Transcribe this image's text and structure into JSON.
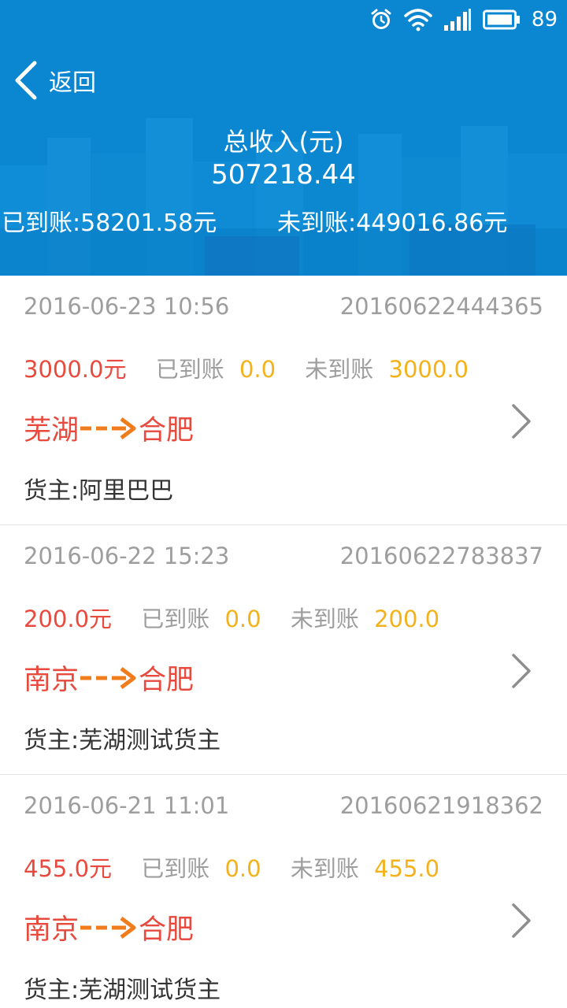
{
  "status_bar": {
    "battery_level": "89",
    "icons": [
      "alarm-icon",
      "wifi-icon",
      "signal-icon",
      "battery-icon"
    ]
  },
  "header": {
    "back_label": "返回",
    "total_title": "总收入(元)",
    "total_value": "507218.44",
    "paid_summary": "已到账:58201.58元",
    "unpaid_summary": "未到账:449016.86元"
  },
  "colors": {
    "header_bg": "#0b86d0",
    "amount_red": "#e84a3d",
    "value_yellow": "#f3b21b",
    "arrow_orange": "#f07c1c",
    "muted_gray": "#9e9e9e"
  },
  "orders": [
    {
      "date": "2016-06-23 10:56",
      "order_no": "20160622444365",
      "amount": "3000.0元",
      "paid_label": "已到账",
      "paid_value": "0.0",
      "unpaid_label": "未到账",
      "unpaid_value": "3000.0",
      "from": "芜湖",
      "to": "合肥",
      "owner": "货主:阿里巴巴"
    },
    {
      "date": "2016-06-22 15:23",
      "order_no": "20160622783837",
      "amount": "200.0元",
      "paid_label": "已到账",
      "paid_value": "0.0",
      "unpaid_label": "未到账",
      "unpaid_value": "200.0",
      "from": "南京",
      "to": "合肥",
      "owner": "货主:芜湖测试货主"
    },
    {
      "date": "2016-06-21 11:01",
      "order_no": "20160621918362",
      "amount": "455.0元",
      "paid_label": "已到账",
      "paid_value": "0.0",
      "unpaid_label": "未到账",
      "unpaid_value": "455.0",
      "from": "南京",
      "to": "合肥",
      "owner": "货主:芜湖测试货主"
    }
  ]
}
